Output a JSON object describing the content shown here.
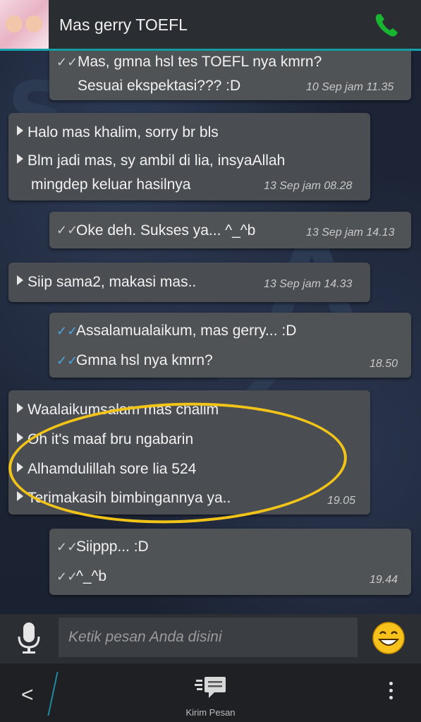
{
  "header": {
    "title": "Mas gerry TOEFL",
    "avatar_icon": "avatar-photo",
    "call_icon": "phone-icon",
    "call_color": "#18b531"
  },
  "messages": [
    {
      "dir": "out",
      "lines": [
        "Mas, gmna hsl tes TOEFL nya kmrn?",
        "Sesuai ekspektasi??? :D"
      ],
      "time": "10 Sep jam 11.35",
      "status": "read"
    },
    {
      "dir": "in",
      "lines": [
        "Halo mas khalim, sorry br bls",
        "Blm jadi mas, sy ambil di lia, insyaAllah",
        "mingdep keluar hasilnya"
      ],
      "time": "13 Sep jam 08.28"
    },
    {
      "dir": "out",
      "lines": [
        "Oke deh. Sukses ya... ^_^b"
      ],
      "time": "13 Sep jam 14.13",
      "status": "read"
    },
    {
      "dir": "in",
      "lines": [
        "Siip sama2, makasi mas.."
      ],
      "time": "13 Sep jam 14.33"
    },
    {
      "dir": "out",
      "lines": [
        "Assalamualaikum, mas gerry... :D",
        "Gmna hsl nya kmrn?"
      ],
      "time": "18.50",
      "status": "delivered"
    },
    {
      "dir": "in",
      "lines": [
        "Waalaikumsalam mas chalim",
        "Oh it's maaf bru ngabarin",
        "Alhamdulillah sore lia 524",
        "Terimakasih bimbingannya ya.."
      ],
      "time": "19.05"
    },
    {
      "dir": "out",
      "lines": [
        "Siippp... :D",
        "^_^b"
      ],
      "time": "19.44",
      "status": "read"
    }
  ],
  "input": {
    "placeholder": "Ketik pesan Anda disini",
    "mic_icon": "microphone-icon",
    "emoji_icon": "smiley-icon"
  },
  "bottom": {
    "back_icon": "back-chevron-icon",
    "send_label": "Kirim Pesan",
    "send_icon": "send-message-icon",
    "more_icon": "more-vertical-icon"
  },
  "annotation": {
    "color": "#f2c418"
  }
}
